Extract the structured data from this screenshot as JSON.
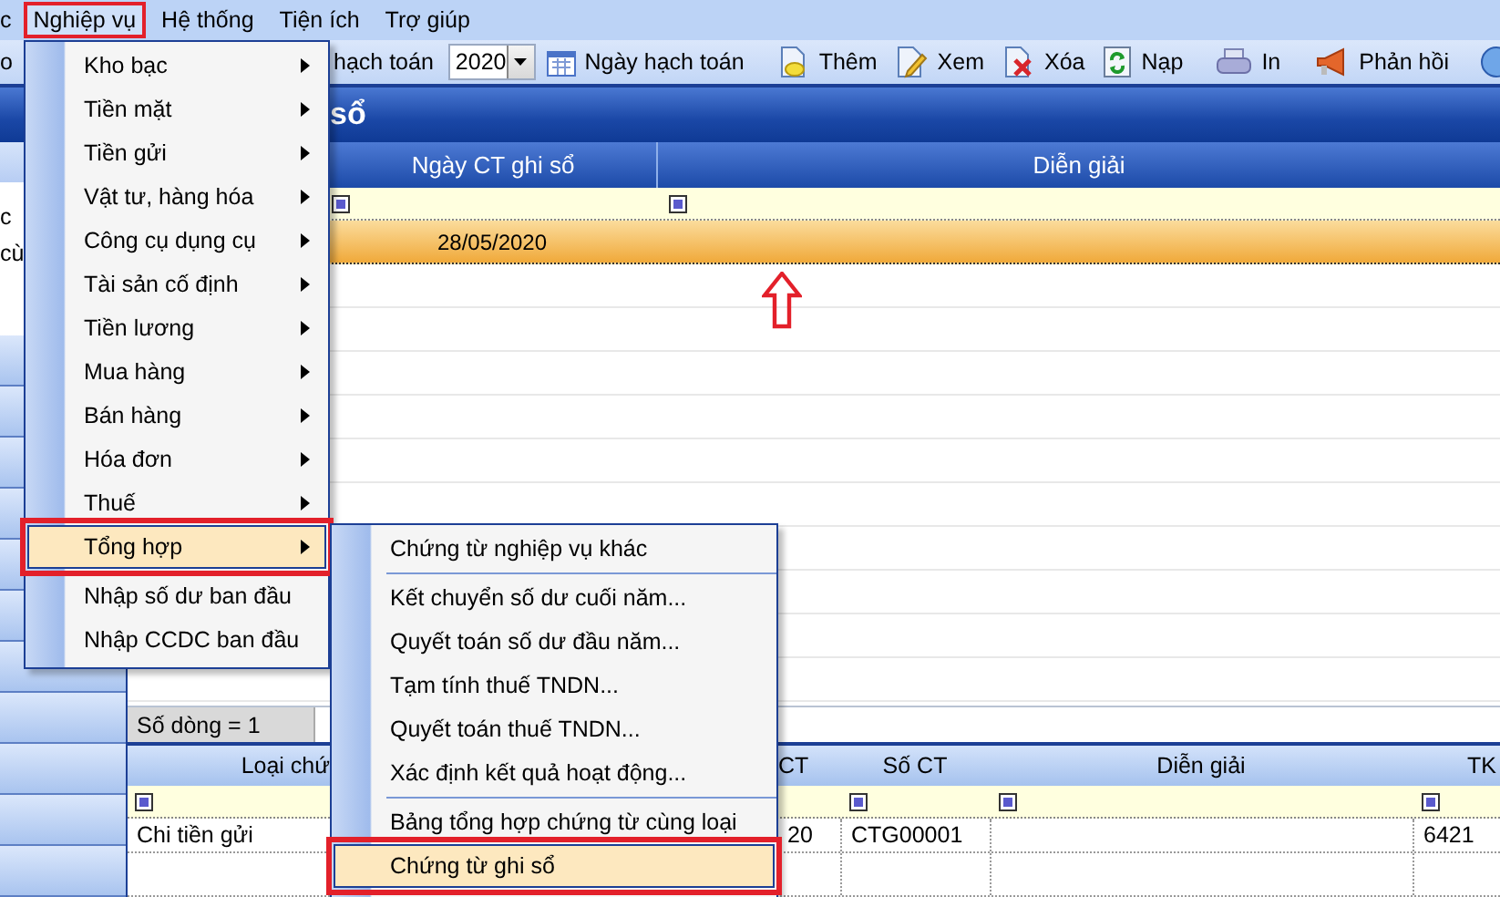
{
  "menubar": [
    {
      "label": "c",
      "selected": false,
      "marked": false
    },
    {
      "label": "Nghiệp vụ",
      "selected": true,
      "marked": true
    },
    {
      "label": "Hệ thống",
      "selected": false,
      "marked": false
    },
    {
      "label": "Tiện ích",
      "selected": false,
      "marked": false
    },
    {
      "label": "Trợ giúp",
      "selected": false,
      "marked": false
    }
  ],
  "toolbar": {
    "leading_text": "o",
    "year_label": "hạch toán",
    "year": "2020",
    "date_button": "Ngày hạch toán",
    "buttons": [
      {
        "label": "Thêm",
        "kind": "add"
      },
      {
        "label": "Xem",
        "kind": "view"
      },
      {
        "label": "Xóa",
        "kind": "delete"
      },
      {
        "label": "Nạp",
        "kind": "reload"
      },
      {
        "label": "In",
        "kind": "print"
      },
      {
        "label": "Phản hồi",
        "kind": "feedback"
      }
    ]
  },
  "panel": {
    "title": "sổ"
  },
  "sidebar": {
    "texts": [
      "c",
      "cù"
    ]
  },
  "upper_grid": {
    "columns": [
      "Ngày CT ghi sổ",
      "Diễn giải"
    ],
    "rows": [
      {
        "date": "28/05/2020",
        "selected": true
      }
    ],
    "row_count": "Số dòng = 1"
  },
  "lower_grid": {
    "columns": [
      "Loại chứ",
      "CT",
      "Số CT",
      "Diễn giải",
      "TK"
    ],
    "rows": [
      {
        "column_1": "Chi tiền gửi",
        "column_2": "20",
        "so_ct": "CTG00001",
        "tk": "6421"
      }
    ]
  },
  "menu": {
    "groups": [
      [
        {
          "label": "Kho bạc",
          "has_submenu": true,
          "highlighted": false,
          "marked": false
        },
        {
          "label": "Tiền mặt",
          "has_submenu": true,
          "highlighted": false,
          "marked": false
        },
        {
          "label": "Tiền gửi",
          "has_submenu": true,
          "highlighted": false,
          "marked": false
        },
        {
          "label": "Vật tư, hàng hóa",
          "has_submenu": true,
          "highlighted": false,
          "marked": false
        },
        {
          "label": "Công cụ dụng cụ",
          "has_submenu": true,
          "highlighted": false,
          "marked": false
        },
        {
          "label": "Tài sản cố định",
          "has_submenu": true,
          "highlighted": false,
          "marked": false
        },
        {
          "label": "Tiền lương",
          "has_submenu": true,
          "highlighted": false,
          "marked": false
        },
        {
          "label": "Mua hàng",
          "has_submenu": true,
          "highlighted": false,
          "marked": false
        },
        {
          "label": "Bán hàng",
          "has_submenu": true,
          "highlighted": false,
          "marked": false
        },
        {
          "label": "Hóa đơn",
          "has_submenu": true,
          "highlighted": false,
          "marked": false
        },
        {
          "label": "Thuế",
          "has_submenu": true,
          "highlighted": false,
          "marked": false
        },
        {
          "label": "Tổng hợp",
          "has_submenu": true,
          "highlighted": true,
          "marked": true
        }
      ],
      [
        {
          "label": "Nhập số dư ban đầu",
          "has_submenu": false,
          "highlighted": false,
          "marked": false
        },
        {
          "label": "Nhập CCDC ban đầu",
          "has_submenu": false,
          "highlighted": false,
          "marked": false
        }
      ]
    ]
  },
  "submenu": {
    "groups": [
      [
        {
          "label": "Chứng từ nghiệp vụ khác",
          "has_submenu": false,
          "highlighted": false,
          "marked": false
        }
      ],
      [
        {
          "label": "Kết chuyển số dư cuối năm...",
          "has_submenu": false,
          "highlighted": false,
          "marked": false
        },
        {
          "label": "Quyết toán số dư đầu năm...",
          "has_submenu": false,
          "highlighted": false,
          "marked": false
        },
        {
          "label": "Tạm tính thuế TNDN...",
          "has_submenu": false,
          "highlighted": false,
          "marked": false
        },
        {
          "label": "Quyết toán thuế TNDN...",
          "has_submenu": false,
          "highlighted": false,
          "marked": false
        },
        {
          "label": "Xác định kết quả hoạt động...",
          "has_submenu": false,
          "highlighted": false,
          "marked": false
        }
      ],
      [
        {
          "label": "Bảng tổng hợp chứng từ cùng loại",
          "has_submenu": false,
          "highlighted": false,
          "marked": false
        },
        {
          "label": "Chứng từ ghi sổ",
          "has_submenu": false,
          "highlighted": true,
          "marked": true
        }
      ]
    ]
  }
}
